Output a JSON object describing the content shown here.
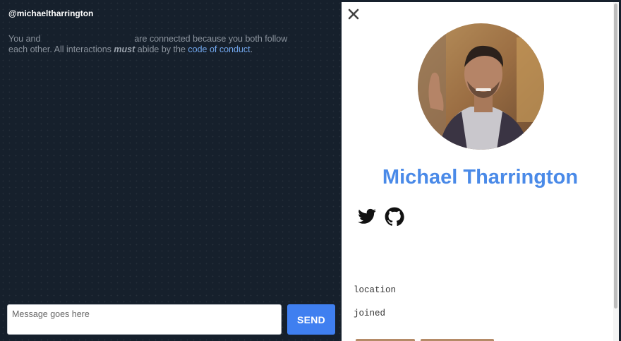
{
  "chat": {
    "header": "@michaeltharrington",
    "notice_part1": "You and",
    "notice_part2": "are connected because you both follow each other. All interactions",
    "notice_emphasis": "must",
    "notice_part3": "abide by the",
    "notice_link": "code of conduct",
    "notice_end": "."
  },
  "composer": {
    "placeholder": "Message goes here",
    "send_label": "SEND"
  },
  "profile": {
    "name": "Michael Tharrington",
    "location_label": "location",
    "joined_label": "joined",
    "social": [
      "twitter-icon",
      "github-icon"
    ]
  },
  "colors": {
    "chat_background": "#16202c",
    "accent_blue": "#3f7ff0",
    "name_blue": "#4a8ae8",
    "link_blue": "#6fa3e8"
  }
}
